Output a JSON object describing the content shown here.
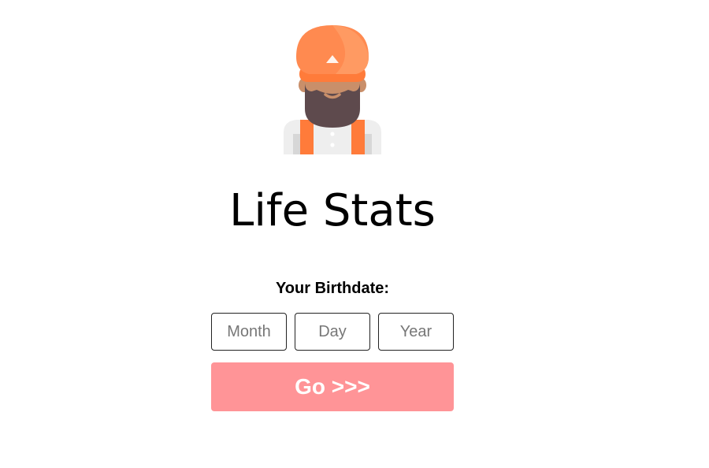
{
  "app": {
    "title": "Life Stats"
  },
  "avatar": {
    "icon": "turban-man-icon"
  },
  "form": {
    "birthdate_label": "Your Birthdate:",
    "month": {
      "placeholder": "Month",
      "value": ""
    },
    "day": {
      "placeholder": "Day",
      "value": ""
    },
    "year": {
      "placeholder": "Year",
      "value": ""
    },
    "go_label": "Go >>>"
  },
  "colors": {
    "accent": "#ff9497",
    "turban": "#ff8a50",
    "skin": "#c98f6a",
    "beard": "#5e4a4d",
    "suspenders": "#ff7b3a",
    "shirt": "#eeeeee"
  }
}
